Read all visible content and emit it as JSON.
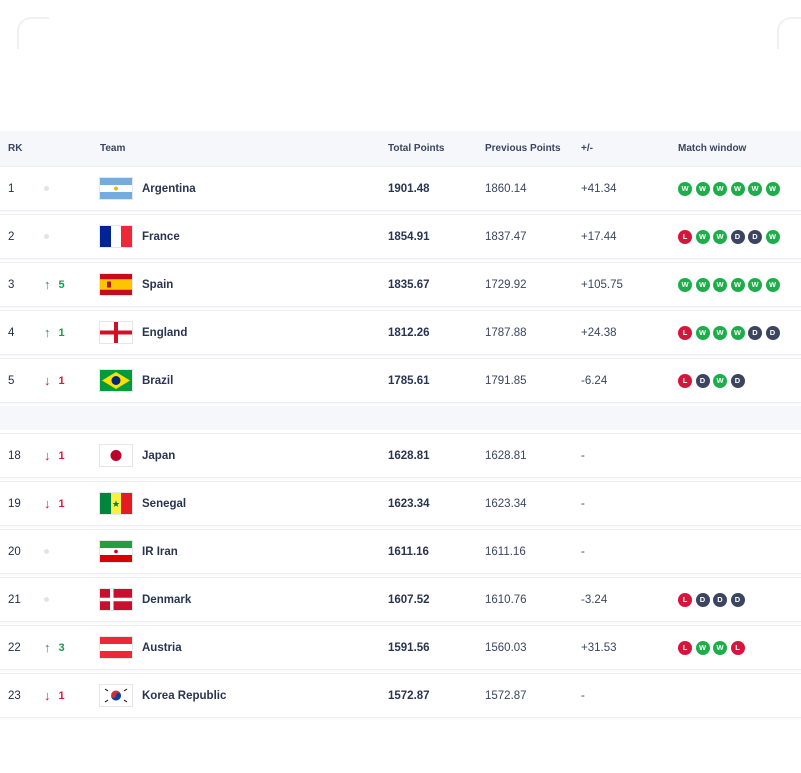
{
  "header": {
    "rank": "RK",
    "team": "Team",
    "total_points": "Total Points",
    "previous_points": "Previous Points",
    "diff": "+/-",
    "match_window": "Match window"
  },
  "colors": {
    "win": "#1dae4b",
    "loss": "#d3163b",
    "draw": "#3c4560",
    "up": "#1a9b48",
    "down": "#d21e3a"
  },
  "rows": [
    {
      "rank": "1",
      "move_dir": "none",
      "move": "",
      "team": "Argentina",
      "flag": "argentina-flag",
      "total": "1901.48",
      "previous": "1860.14",
      "diff": "+41.34",
      "results": [
        "W",
        "W",
        "W",
        "W",
        "W",
        "W"
      ]
    },
    {
      "rank": "2",
      "move_dir": "none",
      "move": "",
      "team": "France",
      "flag": "france-flag",
      "total": "1854.91",
      "previous": "1837.47",
      "diff": "+17.44",
      "results": [
        "L",
        "W",
        "W",
        "D",
        "D",
        "W"
      ]
    },
    {
      "rank": "3",
      "move_dir": "up",
      "move": "5",
      "team": "Spain",
      "flag": "spain-flag",
      "total": "1835.67",
      "previous": "1729.92",
      "diff": "+105.75",
      "results": [
        "W",
        "W",
        "W",
        "W",
        "W",
        "W"
      ]
    },
    {
      "rank": "4",
      "move_dir": "up",
      "move": "1",
      "team": "England",
      "flag": "england-flag",
      "total": "1812.26",
      "previous": "1787.88",
      "diff": "+24.38",
      "results": [
        "L",
        "W",
        "W",
        "W",
        "D",
        "D"
      ]
    },
    {
      "rank": "5",
      "move_dir": "down",
      "move": "1",
      "team": "Brazil",
      "flag": "brazil-flag",
      "total": "1785.61",
      "previous": "1791.85",
      "diff": "-6.24",
      "results": [
        "L",
        "D",
        "W",
        "D"
      ]
    }
  ],
  "rows2": [
    {
      "rank": "18",
      "move_dir": "down",
      "move": "1",
      "team": "Japan",
      "flag": "japan-flag",
      "total": "1628.81",
      "previous": "1628.81",
      "diff": "-",
      "results": []
    },
    {
      "rank": "19",
      "move_dir": "down",
      "move": "1",
      "team": "Senegal",
      "flag": "senegal-flag",
      "total": "1623.34",
      "previous": "1623.34",
      "diff": "-",
      "results": []
    },
    {
      "rank": "20",
      "move_dir": "none",
      "move": "",
      "team": "IR Iran",
      "flag": "iran-flag",
      "total": "1611.16",
      "previous": "1611.16",
      "diff": "-",
      "results": []
    },
    {
      "rank": "21",
      "move_dir": "none",
      "move": "",
      "team": "Denmark",
      "flag": "denmark-flag",
      "total": "1607.52",
      "previous": "1610.76",
      "diff": "-3.24",
      "results": [
        "L",
        "D",
        "D",
        "D"
      ]
    },
    {
      "rank": "22",
      "move_dir": "up",
      "move": "3",
      "team": "Austria",
      "flag": "austria-flag",
      "total": "1591.56",
      "previous": "1560.03",
      "diff": "+31.53",
      "results": [
        "L",
        "W",
        "W",
        "L"
      ]
    },
    {
      "rank": "23",
      "move_dir": "down",
      "move": "1",
      "team": "Korea Republic",
      "flag": "korea-flag",
      "total": "1572.87",
      "previous": "1572.87",
      "diff": "-",
      "results": []
    }
  ]
}
